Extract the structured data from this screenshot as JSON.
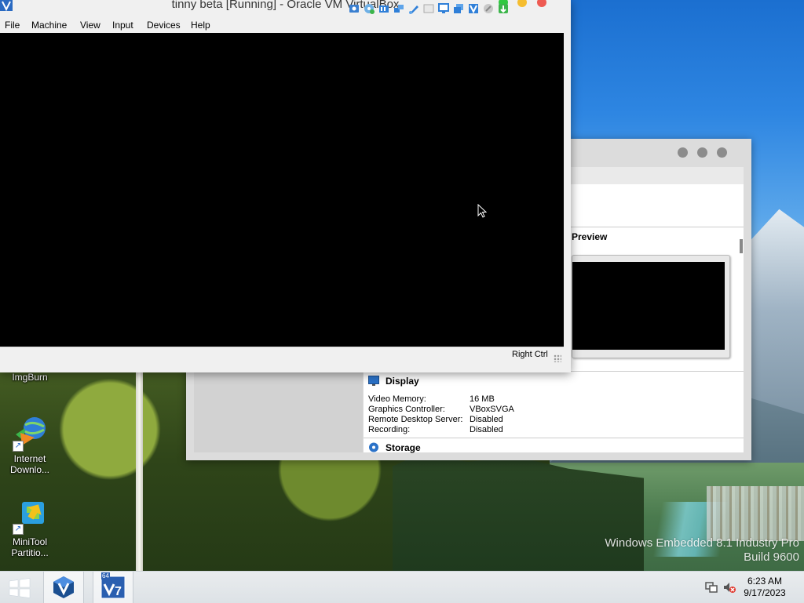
{
  "vm_window": {
    "title": "tinny beta [Running] - Oracle VM VirtualBox",
    "menu": [
      "File",
      "Machine",
      "View",
      "Input",
      "Devices",
      "Help"
    ],
    "status_bar": {
      "icons": [
        "hard-disk-icon",
        "optical-drive-icon",
        "audio-icon",
        "network-icon",
        "usb-icon",
        "shared-folder-icon",
        "display-icon",
        "video-capture-icon",
        "virtualization-icon",
        "mouse-integration-icon",
        "host-key-icon"
      ],
      "host_key": "Right Ctrl"
    }
  },
  "manager_window": {
    "preview_heading": "Preview",
    "display": {
      "heading": "Display",
      "rows": [
        {
          "label": "Video Memory:",
          "value": "16 MB"
        },
        {
          "label": "Graphics Controller:",
          "value": "VBoxSVGA"
        },
        {
          "label": "Remote Desktop Server:",
          "value": "Disabled"
        },
        {
          "label": "Recording:",
          "value": "Disabled"
        }
      ]
    },
    "storage": {
      "heading": "Storage"
    }
  },
  "desktop": {
    "icons": [
      {
        "label": "ImgBurn"
      },
      {
        "label": "Internet Downlo..."
      },
      {
        "label": "MiniTool Partitio..."
      }
    ],
    "branding": {
      "line1": "Windows Embedded 8.1 Industry Pro",
      "line2": "Build 9600"
    }
  },
  "taskbar": {
    "buttons": [
      "start-button",
      "virtualbox-taskbar-button",
      "windows7-usb-tool-taskbar-button"
    ],
    "badge": "64",
    "clock": {
      "time": "6:23 AM",
      "date": "9/17/2023"
    }
  },
  "colors": {
    "mac_close": "#ee5a52",
    "mac_min": "#f5bd2f",
    "mac_max": "#2fc840",
    "vm_screen": "#000000"
  }
}
